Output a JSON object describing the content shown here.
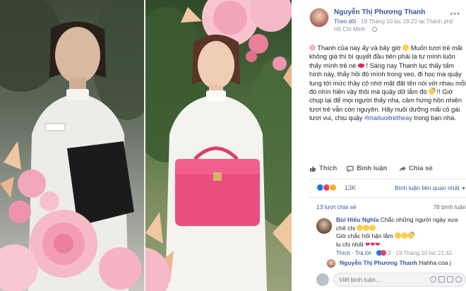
{
  "post": {
    "author": "Nguyễn Thị Phương Thanh",
    "follow_label": "Theo dõi",
    "meta": " · 19 Tháng 10 lúc 18:23 tại Thành phố Hồ Chí Minh · ",
    "more_icon": "ellipsis-icon",
    "text_part1": " Thanh của này ấy và bây giờ ",
    "text_part2": " Muốn tươi trẻ mãi không già thì bí quyết đầu tiên phải là tự mình luôn thấy mình trẻ nè ",
    "text_part3": " ! Sáng nay Thanh lục thấy tấm hình này, thấy hồi đó mình trong veo, đi học mà quậy tung tới mức thầy cô nhớ mặt đặt tên nói với nhau mỗi đó nhìn hiền vậy thôi mà quậy dữ lắm đó ",
    "text_part4": " !! Giờ chụp lại để mọi người thấy nha, cảm hứng hồn nhiên tươi trẻ vẫn còn nguyên. Hãy nuôi dưỡng mãi cô gái tươi vui, chịu quậy ",
    "hashtag": "#maituoitretheay",
    "text_part5": " trong bạn nha."
  },
  "actions": {
    "like": "Thích",
    "comment": "Bình luận",
    "share": "Chia sẻ"
  },
  "stats": {
    "reaction_count": "13K",
    "related_link": "Bình luận liên quan nhất",
    "shares": "13 lượt chia sẻ",
    "comments": "78 bình luận"
  },
  "comment": {
    "author": "Bùi Hiếu Nghĩa",
    "text_part1": " Chắc những người ngày xưa chê chị ",
    "text_part2": " Giờ chắc hối hận lắm ",
    "text_part3": " lu chị nhất ",
    "like": "Thích",
    "reply": "Trả lời",
    "reaction_count": "2",
    "time": "19 Tháng 10 lúc 21:42"
  },
  "reply": {
    "author": "Nguyễn Thị Phương Thanh",
    "text": " Hahha coa j"
  },
  "write_comment": {
    "placeholder": "Viết bình luận..."
  },
  "colors": {
    "link_blue": "#385898",
    "meta_gray": "#90949c",
    "like_blue": "#1877f2",
    "love_red": "#f33e58",
    "haha_yellow": "#f7b125"
  }
}
